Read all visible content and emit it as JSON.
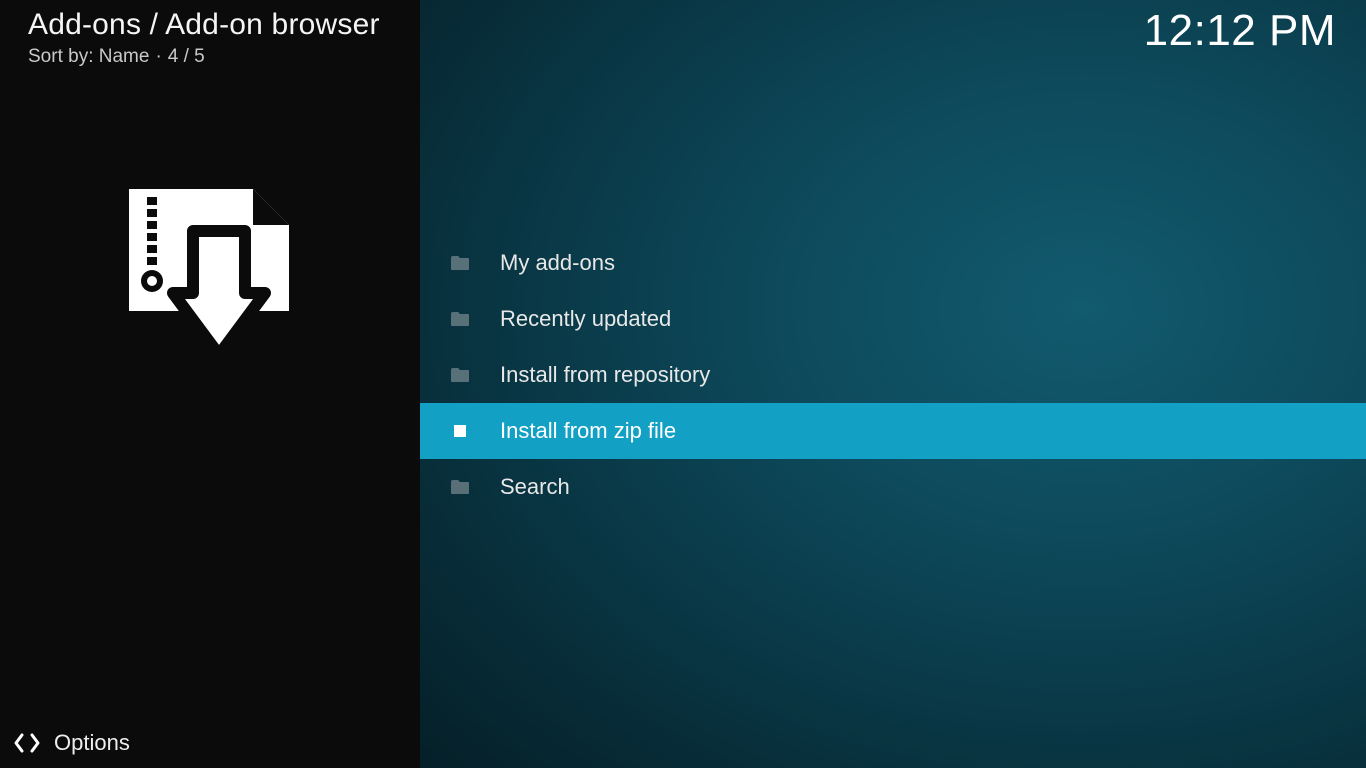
{
  "header": {
    "title": "Add-ons / Add-on browser",
    "sort_label": "Sort by: Name",
    "position": "4 / 5"
  },
  "clock": "12:12 PM",
  "options_label": "Options",
  "list": {
    "items": [
      {
        "label": "My add-ons",
        "icon": "folder",
        "selected": false
      },
      {
        "label": "Recently updated",
        "icon": "folder",
        "selected": false
      },
      {
        "label": "Install from repository",
        "icon": "folder",
        "selected": false
      },
      {
        "label": "Install from zip file",
        "icon": "zip",
        "selected": true
      },
      {
        "label": "Search",
        "icon": "folder",
        "selected": false
      }
    ]
  },
  "icons": {
    "folder": "folder-icon",
    "zip": "zip-file-icon",
    "options": "options-arrows-icon",
    "sidebar": "install-zip-large-icon"
  }
}
